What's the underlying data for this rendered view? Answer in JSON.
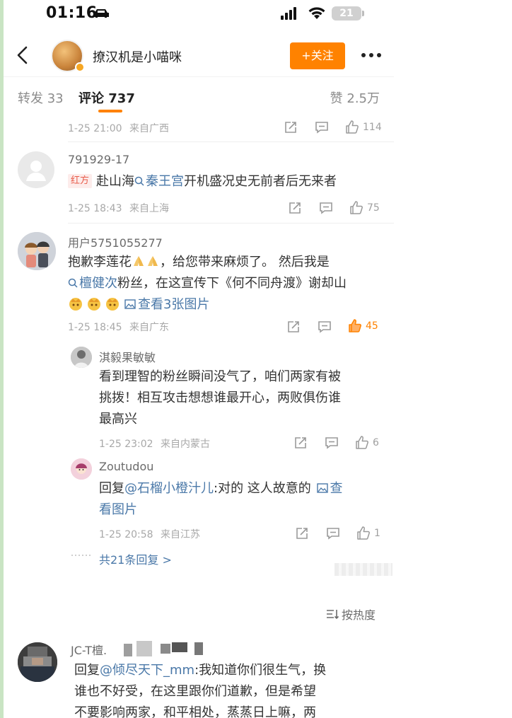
{
  "status_bar": {
    "time": "01:16",
    "battery": "21"
  },
  "header": {
    "username": "撩汉机是小喵咪",
    "follow_label": "+关注"
  },
  "tabs": {
    "repost": "转发 33",
    "comment": "评论 737",
    "like": "赞 2.5万"
  },
  "top_meta": {
    "date": "1-25 21:00",
    "location": "来自广西",
    "likes": "114"
  },
  "comments": [
    {
      "user": "791929-17",
      "badge": "红方",
      "text_prefix": "赴山海",
      "topic": "秦王宫",
      "text_suffix": "开机盛况史无前者后无来者",
      "date": "1-25 18:43",
      "location": "来自上海",
      "likes": "75"
    },
    {
      "user": "用户5751055277",
      "line1_a": "抱歉李莲花",
      "line1_b": "，给您带来麻烦了。 然后我是",
      "topic": "檀健次",
      "line2_b": "粉丝，在这宣传下《何不同舟渡》谢却山",
      "images_label": "查看3张图片",
      "date": "1-25 18:45",
      "location": "来自广东",
      "likes": "45"
    }
  ],
  "replies": [
    {
      "user": "淇毅果敏敏",
      "line1": "看到理智的粉丝瞬间没气了，咱们两家有被",
      "line2": "挑拨！相互攻击想想谁最开心，两败俱伤谁",
      "line3": "最高兴",
      "date": "1-25 23:02",
      "location": "来自内蒙古",
      "likes": "6"
    },
    {
      "user": "Zoutudou",
      "prefix": "回复",
      "mention": "@石榴小橙汁儿",
      "text": ":对的 这人故意的",
      "img_label_a": "查",
      "img_label_b": "看图片",
      "date": "1-25 20:58",
      "location": "来自江苏",
      "likes": "1"
    }
  ],
  "more_replies": "共21条回复 >",
  "sort_label": "按热度",
  "last_comment": {
    "user": "JC-T檀.",
    "prefix": "回复",
    "mention": "@倾尽天下_mm",
    "line1": ":我知道你们很生气，换",
    "line2": "谁也不好受，在这里跟你们道歉，但是希望",
    "line3": "不要影响两家，和平相处，蒸蒸日上嘛，两"
  }
}
